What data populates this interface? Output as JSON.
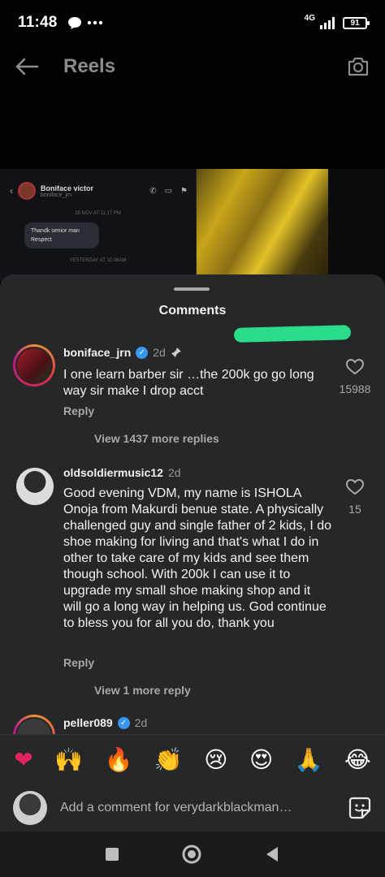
{
  "status": {
    "time": "11:48",
    "network": "4G",
    "battery": "91"
  },
  "header": {
    "title": "Reels"
  },
  "preview": {
    "dm_name": "Boniface victor",
    "dm_handle": "boniface_jrn",
    "dm_date1": "28 NOV AT 11:17 PM",
    "dm_message": "Thandk senior man Respect",
    "dm_date2": "YESTERDAY AT 10:06AM"
  },
  "sheet": {
    "title": "Comments"
  },
  "comments": [
    {
      "username": "boniface_jrn",
      "age": "2d",
      "verified": true,
      "pinned": true,
      "text": "I one learn barber sir …the 200k go go long way sir make I drop acct",
      "reply": "Reply",
      "likes": "15988",
      "view_replies": "View 1437 more replies"
    },
    {
      "username": "oldsoldiermusic12",
      "age": "2d",
      "verified": false,
      "text": "Good evening VDM, my name is ISHOLA Onoja from Makurdi benue state. A physically challenged guy and single father of 2 kids, I do shoe making for living and that's what I do in other to take care of my kids and see them though school. With 200k I can use it to upgrade my small shoe making shop and it will go a long way in helping us. God continue to bless you for all you do, thank you",
      "reply": "Reply",
      "likes": "15",
      "view_replies": "View 1 more reply"
    },
    {
      "username": "peller089",
      "age": "2d",
      "verified": true
    }
  ],
  "emojis": [
    "❤",
    "🙌",
    "🔥",
    "👏",
    "😢",
    "😍",
    "🙏",
    "😂"
  ],
  "composer": {
    "placeholder": "Add a comment for verydarkblackman…"
  },
  "colors": {
    "sheet_bg": "#262729",
    "highlight": "#2bdc8a",
    "verified": "#3897f0"
  }
}
